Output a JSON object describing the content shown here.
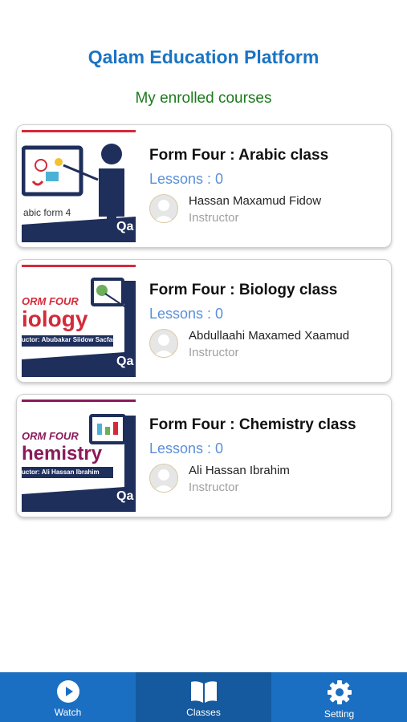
{
  "header": {
    "title": "Qalam Education Platform",
    "subtitle": "My enrolled courses"
  },
  "courses": [
    {
      "title": "Form Four : Arabic class",
      "lessons": "Lessons : 0",
      "instructor_name": "Hassan Maxamud Fidow",
      "instructor_role": "Instructor",
      "thumbnail": {
        "caption": "abic form 4",
        "brand": "Qa"
      }
    },
    {
      "title": "Form Four : Biology class",
      "lessons": "Lessons : 0",
      "instructor_name": "Abdullaahi Maxamed Xaamud",
      "instructor_role": "Instructor",
      "thumbnail": {
        "line1": "ORM FOUR",
        "line2": "iology",
        "line3": "uctor: Abubakar Siidow Sacfar",
        "brand": "Qa"
      }
    },
    {
      "title": "Form Four : Chemistry class",
      "lessons": "Lessons : 0",
      "instructor_name": "Ali Hassan Ibrahim",
      "instructor_role": "Instructor",
      "thumbnail": {
        "line1": "ORM FOUR",
        "line2": "hemistry",
        "line3": "uctor: Ali Hassan Ibrahim",
        "brand": "Qa"
      }
    }
  ],
  "bottom_nav": {
    "items": [
      {
        "label": "Watch",
        "icon": "play-circle-icon"
      },
      {
        "label": "Classes",
        "icon": "book-icon",
        "active": true
      },
      {
        "label": "Setting",
        "icon": "gear-icon"
      }
    ]
  },
  "colors": {
    "brand_blue": "#1a74c4",
    "nav_blue": "#1b6fc2",
    "nav_active": "#15599e",
    "subtitle_green": "#1c7a1c",
    "lessons_blue": "#5b8fd8",
    "thumb_navy": "#1f2f5c",
    "thumb_red": "#d42a3a",
    "thumb_purple": "#8a1a5a"
  }
}
